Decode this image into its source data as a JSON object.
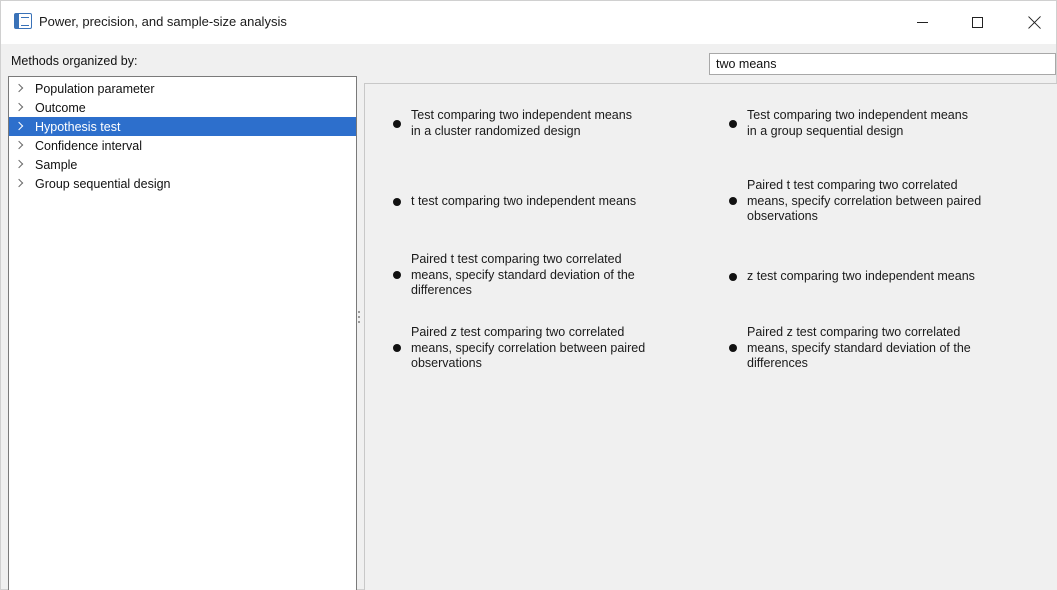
{
  "window": {
    "title": "Power, precision, and sample-size analysis",
    "icon": "table-window-icon",
    "controls": [
      "minimize",
      "maximize",
      "close"
    ]
  },
  "methods_label": "Methods organized by:",
  "search": {
    "value": "two means"
  },
  "tree": {
    "selected_index": 2,
    "items": [
      {
        "label": "Population parameter"
      },
      {
        "label": "Outcome"
      },
      {
        "label": "Hypothesis test"
      },
      {
        "label": "Confidence interval"
      },
      {
        "label": "Sample"
      },
      {
        "label": "Group sequential design"
      }
    ]
  },
  "methods": [
    {
      "lines": [
        "Test comparing two independent means",
        "in a cluster randomized design"
      ]
    },
    {
      "lines": [
        "Test comparing two independent means",
        "in a group sequential design"
      ]
    },
    {
      "lines": [
        "t test comparing two independent means"
      ]
    },
    {
      "lines": [
        "Paired t test comparing two correlated",
        "means, specify correlation between paired",
        "observations"
      ]
    },
    {
      "lines": [
        "Paired t test comparing two correlated",
        "means, specify standard deviation of the",
        "differences"
      ]
    },
    {
      "lines": [
        "z test comparing two independent means"
      ]
    },
    {
      "lines": [
        "Paired z test comparing two correlated",
        "means, specify correlation between paired",
        "observations"
      ]
    },
    {
      "lines": [
        "Paired z test comparing two correlated",
        "means, specify standard deviation of the",
        "differences"
      ]
    }
  ]
}
